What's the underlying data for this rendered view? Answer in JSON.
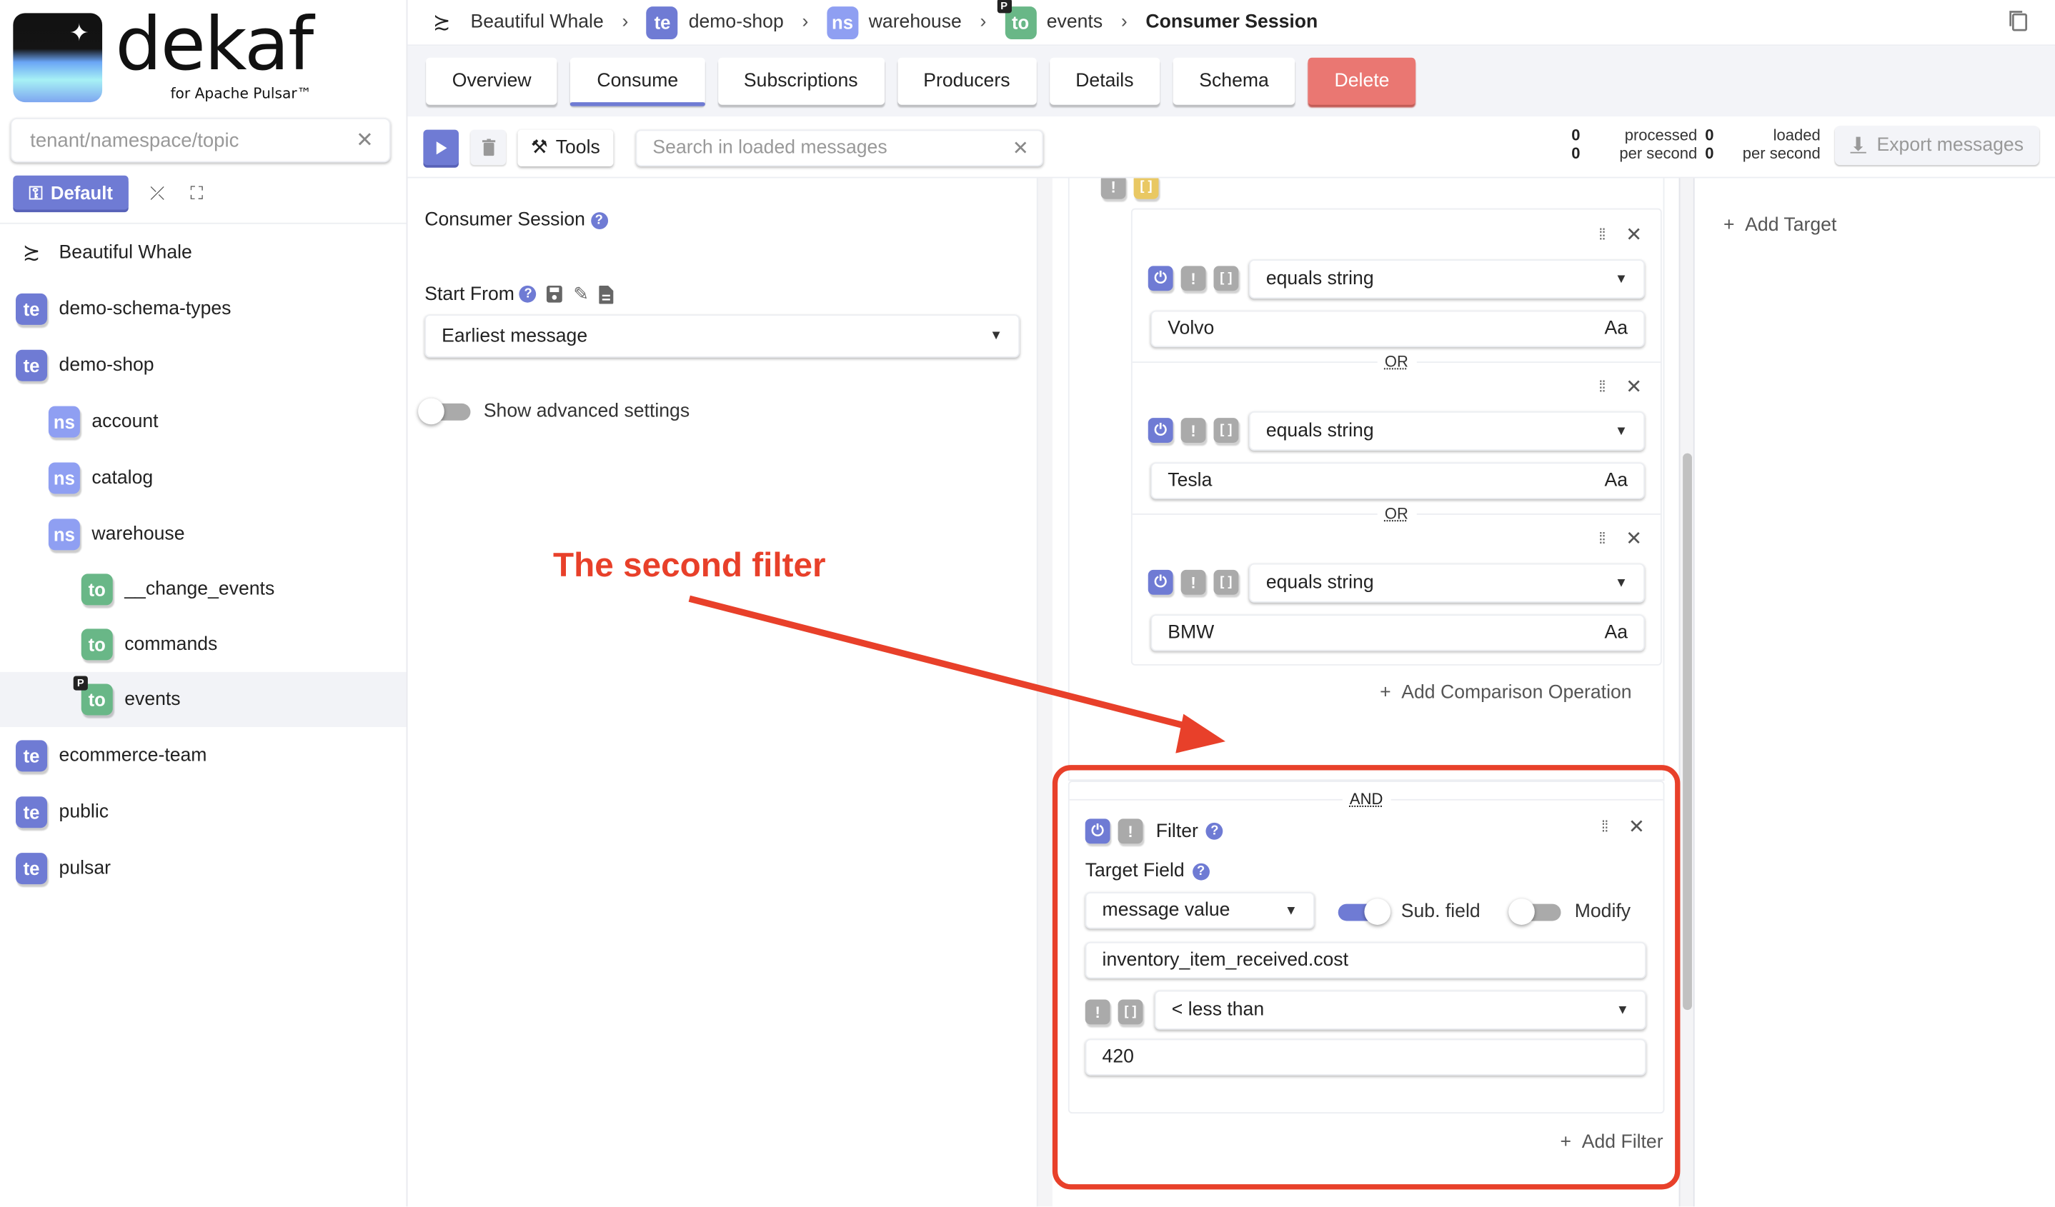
{
  "app": {
    "logo_word": "dekaf",
    "logo_sub": "for Apache Pulsar™"
  },
  "sidebar": {
    "search_placeholder": "tenant/namespace/topic",
    "default_button": "Default",
    "tree": [
      {
        "type": "instance",
        "badge": "",
        "label": "Beautiful Whale",
        "level": 0
      },
      {
        "type": "te",
        "badge": "te",
        "label": "demo-schema-types",
        "level": 0
      },
      {
        "type": "te",
        "badge": "te",
        "label": "demo-shop",
        "level": 0
      },
      {
        "type": "ns",
        "badge": "ns",
        "label": "account",
        "level": 1
      },
      {
        "type": "ns",
        "badge": "ns",
        "label": "catalog",
        "level": 1
      },
      {
        "type": "ns",
        "badge": "ns",
        "label": "warehouse",
        "level": 1
      },
      {
        "type": "to",
        "badge": "to",
        "label": "__change_events",
        "level": 2
      },
      {
        "type": "to",
        "badge": "to",
        "label": "commands",
        "level": 2
      },
      {
        "type": "to",
        "badge": "to",
        "label": "events",
        "level": 2,
        "persistent_badge": "P",
        "active": true
      },
      {
        "type": "te",
        "badge": "te",
        "label": "ecommerce-team",
        "level": 0
      },
      {
        "type": "te",
        "badge": "te",
        "label": "public",
        "level": 0
      },
      {
        "type": "te",
        "badge": "te",
        "label": "pulsar",
        "level": 0
      }
    ]
  },
  "breadcrumb": {
    "items": [
      {
        "badge": "",
        "label": "Beautiful Whale"
      },
      {
        "badge": "te",
        "label": "demo-shop"
      },
      {
        "badge": "ns",
        "label": "warehouse"
      },
      {
        "badge": "to",
        "label": "events",
        "persistent_badge": "P"
      }
    ],
    "current": "Consumer Session"
  },
  "tabs": [
    {
      "label": "Overview",
      "active": false
    },
    {
      "label": "Consume",
      "active": true
    },
    {
      "label": "Subscriptions",
      "active": false
    },
    {
      "label": "Producers",
      "active": false
    },
    {
      "label": "Details",
      "active": false
    },
    {
      "label": "Schema",
      "active": false
    },
    {
      "label": "Delete",
      "danger": true
    }
  ],
  "toolbar": {
    "tools_label": "Tools",
    "search_placeholder": "Search in loaded messages",
    "stats": {
      "processed": "0",
      "processed_label": "processed",
      "processed_rate": "0",
      "processed_rate_label": "per second",
      "loaded": "0",
      "loaded_label": "loaded",
      "loaded_rate": "0",
      "loaded_rate_label": "per second"
    },
    "export_label": "Export messages"
  },
  "session": {
    "title": "Consumer Session",
    "start_from_label": "Start From",
    "start_from_value": "Earliest message",
    "advanced_label": "Show advanced settings",
    "advanced_on": false
  },
  "filters": {
    "comparisons": [
      {
        "operator": "equals string",
        "value": "Volvo",
        "case_label": "Aa"
      },
      {
        "operator": "equals string",
        "value": "Tesla",
        "case_label": "Aa"
      },
      {
        "operator": "equals string",
        "value": "BMW",
        "case_label": "Aa"
      }
    ],
    "or_label": "OR",
    "add_comparison_label": "Add Comparison Operation",
    "and_label": "AND",
    "second_filter": {
      "title": "Filter",
      "target_field_label": "Target Field",
      "target_field_value": "message value",
      "subfield_label": "Sub. field",
      "subfield_on": true,
      "modify_label": "Modify",
      "modify_on": false,
      "path_value": "inventory_item_received.cost",
      "operator": "< less than",
      "value": "420"
    },
    "add_filter_label": "Add Filter"
  },
  "targets": {
    "add_target_label": "Add Target"
  },
  "annotation": {
    "text": "The second filter",
    "color": "#e8402a"
  }
}
